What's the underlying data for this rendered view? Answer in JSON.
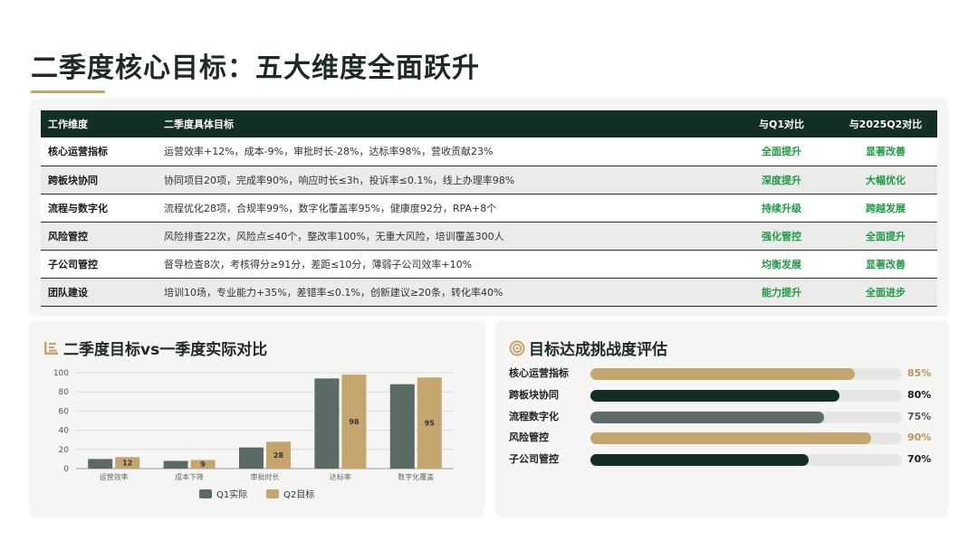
{
  "page": {
    "title": "二季度核心目标：五大维度全面跃升"
  },
  "table": {
    "headers": [
      "工作维度",
      "二季度具体目标",
      "与Q1对比",
      "与2025Q2对比"
    ],
    "rows": [
      [
        "核心运营指标",
        "运营效率+12%，成本-9%，审批时长-28%，达标率98%，营收贡献23%",
        "全面提升",
        "显著改善"
      ],
      [
        "跨板块协同",
        "协同项目20项，完成率90%，响应时长≤3h，投诉率≤0.1%，线上办理率98%",
        "深度提升",
        "大幅优化"
      ],
      [
        "流程与数字化",
        "流程优化28项，合规率99%，数字化覆盖率95%，健康度92分，RPA+8个",
        "持续升级",
        "跨越发展"
      ],
      [
        "风险管控",
        "风险排查22次，风险点≤40个，整改率100%，无重大风险，培训覆盖300人",
        "强化管控",
        "全面提升"
      ],
      [
        "子公司管控",
        "督导检查8次，考核得分≥91分，差距≤10分，薄弱子公司效率+10%",
        "均衡发展",
        "显著改善"
      ],
      [
        "团队建设",
        "培训10场，专业能力+35%，差错率≤0.1%，创新建议≥20条，转化率40%",
        "能力提升",
        "全面进步"
      ]
    ]
  },
  "chart_card": {
    "title": "二季度目标vs一季度实际对比",
    "icon": "bar-chart-icon"
  },
  "chart_data": {
    "type": "bar",
    "categories": [
      "运营效率",
      "成本下降",
      "审批时长",
      "达标率",
      "数字化覆盖"
    ],
    "series": [
      {
        "name": "Q1实际",
        "values": [
          10,
          8,
          22,
          94,
          88
        ],
        "color": "#5a6b63"
      },
      {
        "name": "Q2目标",
        "values": [
          12,
          9,
          28,
          98,
          95
        ],
        "color": "#c4a56e"
      }
    ],
    "data_labels": [
      "12",
      "9",
      "28",
      "98",
      "95"
    ],
    "yticks": [
      0,
      20,
      40,
      60,
      80,
      100
    ],
    "ylim": [
      0,
      100
    ],
    "grid": true,
    "legend": "bottom"
  },
  "eval_card": {
    "title": "目标达成挑战度评估",
    "icon": "target-icon",
    "items": [
      {
        "label": "核心运营指标",
        "value": 85,
        "pct": "85%",
        "color": "#c4a56e",
        "text_color": "#b8965a"
      },
      {
        "label": "跨板块协同",
        "value": 80,
        "pct": "80%",
        "color": "#132e22",
        "text_color": "#1a1a1a"
      },
      {
        "label": "流程数字化",
        "value": 75,
        "pct": "75%",
        "color": "#5f6b66",
        "text_color": "#555555"
      },
      {
        "label": "风险管控",
        "value": 90,
        "pct": "90%",
        "color": "#c4a56e",
        "text_color": "#b8965a"
      },
      {
        "label": "子公司管控",
        "value": 70,
        "pct": "70%",
        "color": "#132e22",
        "text_color": "#1a1a1a"
      }
    ]
  }
}
